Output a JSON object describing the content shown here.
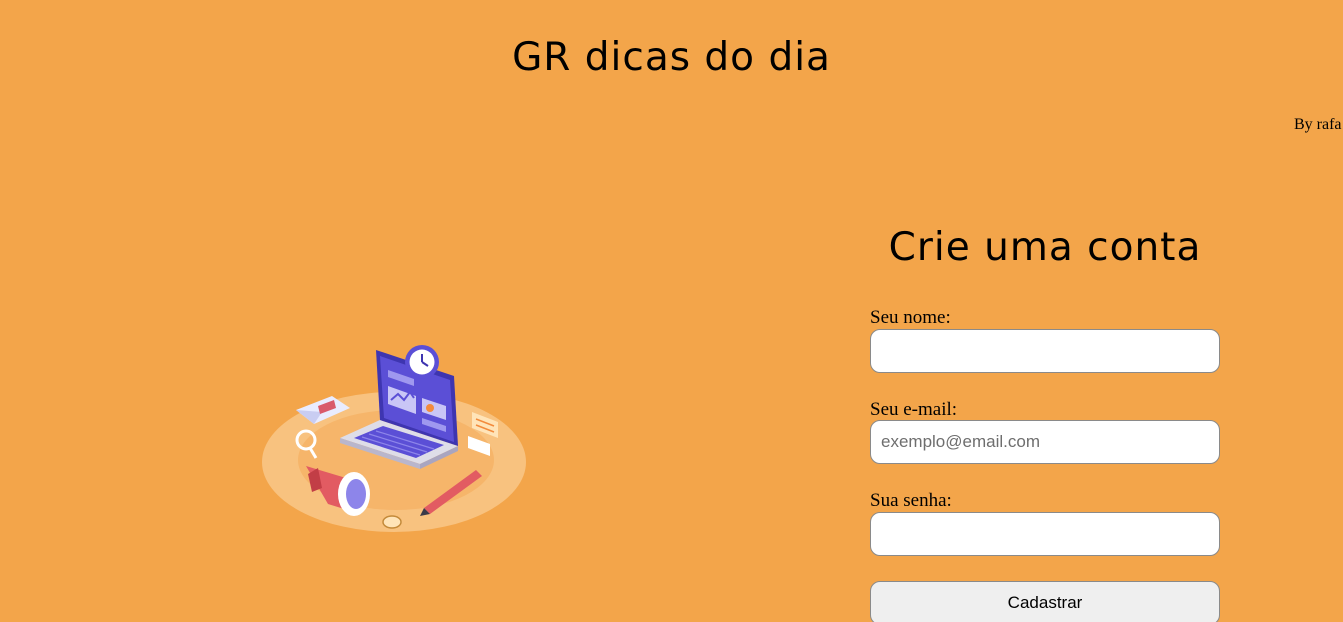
{
  "header": {
    "title": "GR dicas do dia",
    "author": "By rafa"
  },
  "illustration": {
    "icon": "marketing-laptop-illustration"
  },
  "form": {
    "title": "Crie uma conta",
    "name_label": "Seu nome:",
    "name_value": "",
    "name_placeholder": "",
    "email_label": "Seu e-mail:",
    "email_value": "",
    "email_placeholder": "exemplo@email.com",
    "password_label": "Sua senha:",
    "password_value": "",
    "password_placeholder": "",
    "submit_label": "Cadastrar"
  },
  "colors": {
    "background": "#f3a54a",
    "accent": "#5b4fd6"
  }
}
